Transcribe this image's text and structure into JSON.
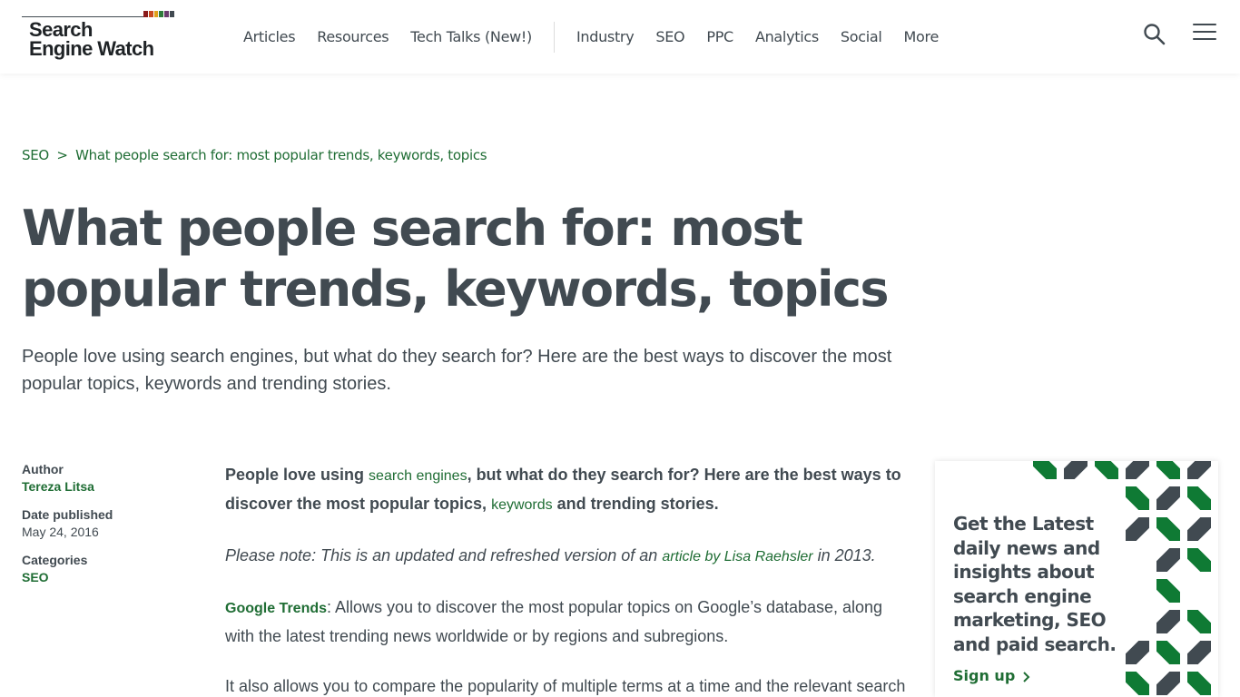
{
  "header": {
    "logo_line1": "Search",
    "logo_line2": "Engine Watch",
    "logo_bar_colors": [
      "#8b1b1b",
      "#c84a1e",
      "#e0a11b",
      "#2f7a3b",
      "#6b3a6e",
      "#414a51"
    ],
    "nav_primary": [
      {
        "label": "Articles"
      },
      {
        "label": "Resources"
      },
      {
        "label": "Tech Talks (New!)"
      }
    ],
    "nav_secondary": [
      {
        "label": "Industry"
      },
      {
        "label": "SEO"
      },
      {
        "label": "PPC"
      },
      {
        "label": "Analytics"
      },
      {
        "label": "Social"
      },
      {
        "label": "More"
      }
    ],
    "search_icon": "search-icon",
    "menu_icon": "hamburger-menu-icon"
  },
  "breadcrumb": {
    "parent": "SEO",
    "separator": ">",
    "current": "What people search for: most popular trends, keywords, topics"
  },
  "article": {
    "title": "What people search for: most popular trends, keywords, topics",
    "subtitle": "People love using search engines, but what do they search for? Here are the best ways to discover the most popular topics, keywords and trending stories.",
    "lead": {
      "part1": "People love using ",
      "link1": "search engines",
      "part2": ", but what do they search for? Here are the best ways to discover the most popular topics, ",
      "link2": "keywords",
      "part3": " and trending stories."
    },
    "note": {
      "part1": "Please note: This is an updated and refreshed version of an ",
      "link": "article by Lisa Raehsler",
      "part2": " in 2013."
    },
    "google_trends": {
      "link": "Google Trends",
      "text": ": Allows you to discover the most popular topics on Google’s database, along with the latest trending news worldwide or by regions and subregions."
    },
    "para4": "It also allows you to compare the popularity of multiple terms at a time and the relevant search"
  },
  "meta": {
    "author_label": "Author",
    "author": "Tereza Litsa",
    "date_label": "Date published",
    "date": "May 24, 2016",
    "categories_label": "Categories",
    "category": "SEO"
  },
  "sidebar_card": {
    "text": "Get the Latest daily news and insights about search engine marketing, SEO and paid search.",
    "link": "Sign up",
    "link_icon": "chevron-right-icon"
  },
  "colors": {
    "brand_green": "#1f6d34",
    "text_gray": "#414a51",
    "pattern_green": "#0f7a34",
    "pattern_gray": "#414a51"
  }
}
